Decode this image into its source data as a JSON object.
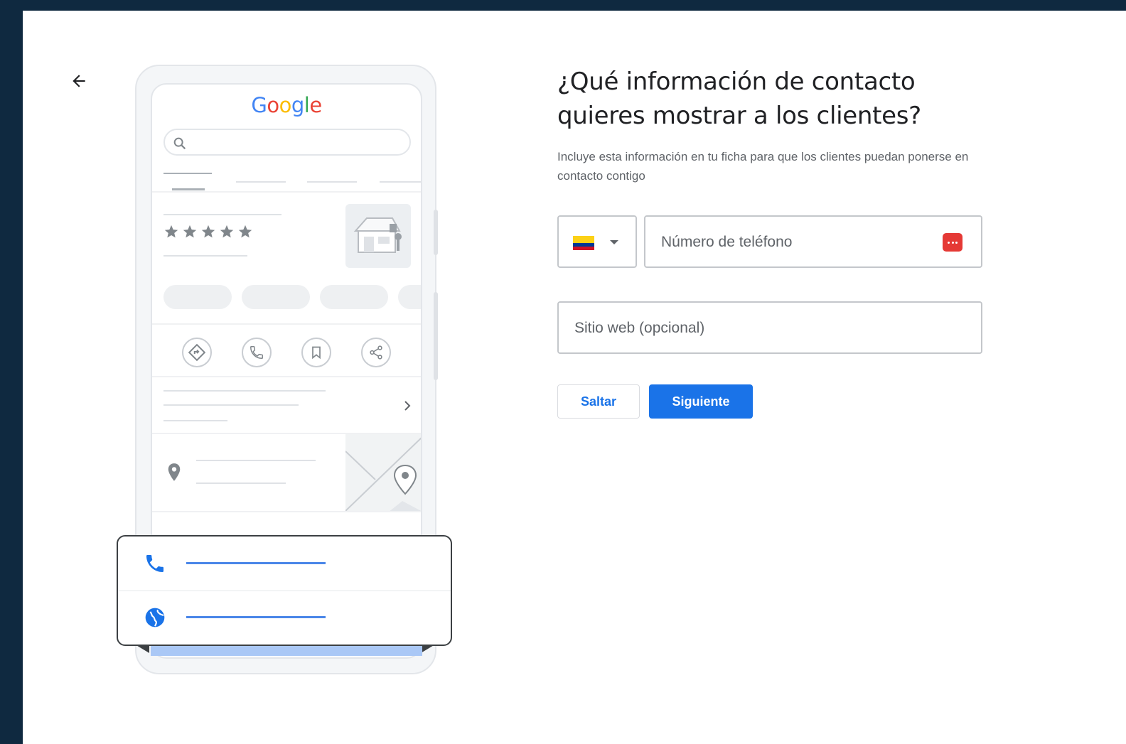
{
  "header": {
    "back_icon": "arrow-left-icon"
  },
  "illustration": {
    "logo_text": "Google",
    "logo_colors": [
      "#4285F4",
      "#EA4335",
      "#FBBC05",
      "#4285F4",
      "#34A853",
      "#EA4335"
    ],
    "rating_stars": 5,
    "action_icons": [
      "directions-icon",
      "phone-icon",
      "bookmark-icon",
      "share-icon"
    ],
    "card_icons": [
      "phone-icon",
      "globe-icon"
    ]
  },
  "form": {
    "title": "¿Qué información de contacto quieres mostrar a los clientes?",
    "subtitle": "Incluye esta información en tu ficha para que los clientes puedan ponerse en contacto contigo",
    "country_flag": "colombia-flag",
    "phone_placeholder": "Número de teléfono",
    "website_placeholder": "Sitio web (opcional)",
    "skip_label": "Saltar",
    "next_label": "Siguiente"
  },
  "colors": {
    "primary": "#1a73e8",
    "frame_background": "#0f2940",
    "card_accent": "#4a86e8"
  }
}
